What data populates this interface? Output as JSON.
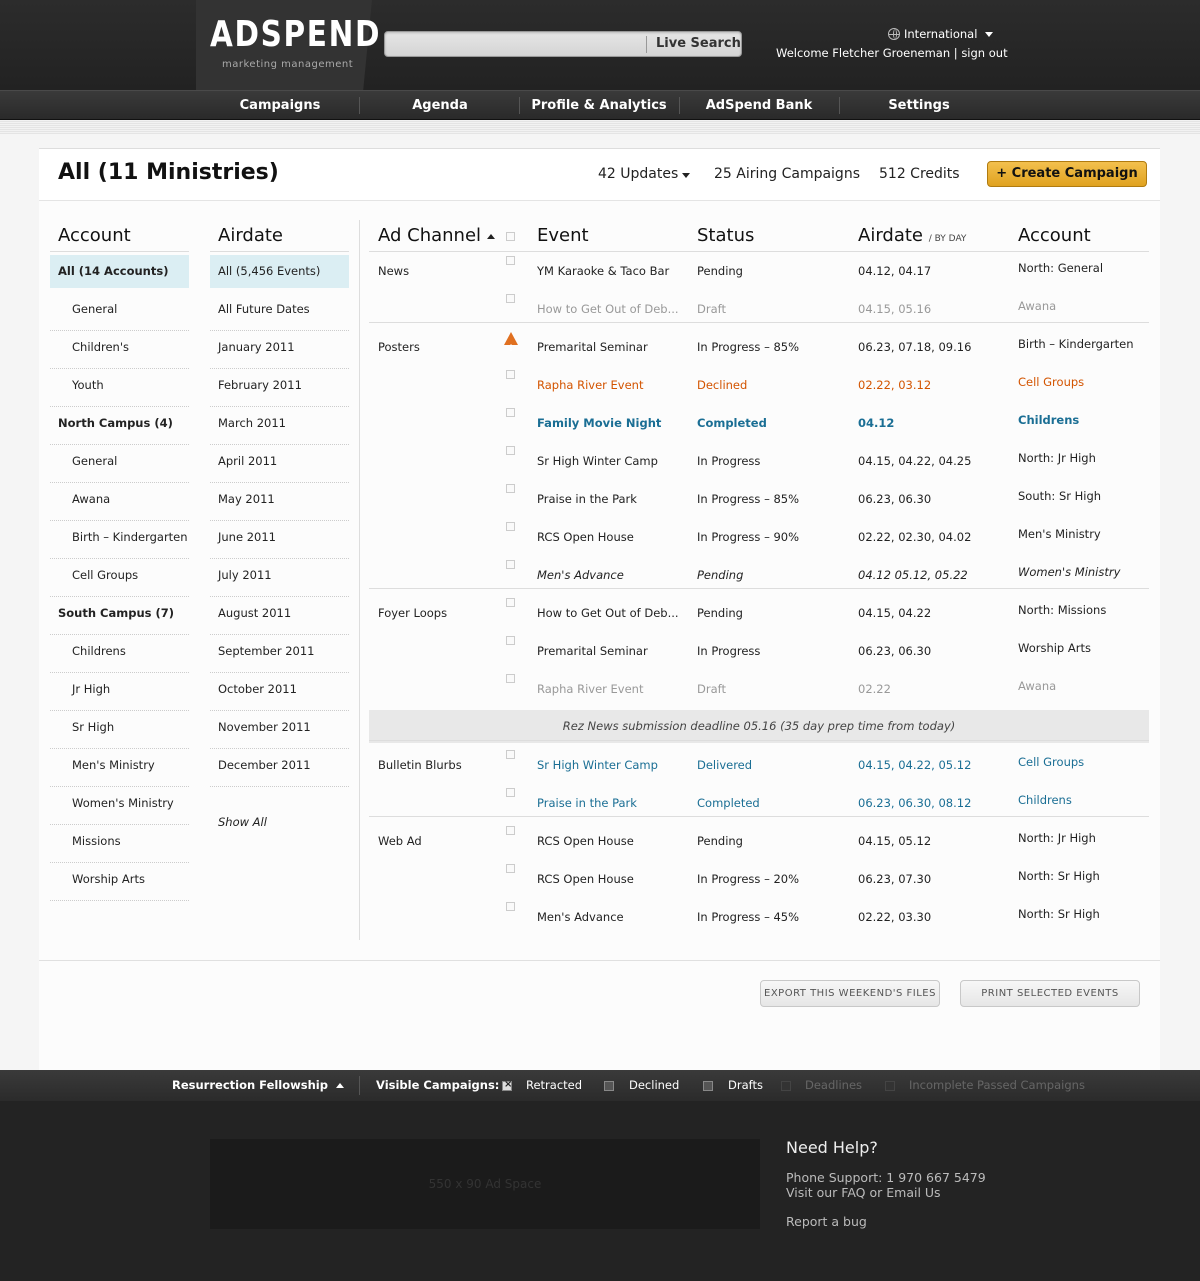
{
  "header": {
    "logo": "ADSPEND",
    "tagline": "marketing management",
    "search": {
      "placeholder": "",
      "label": "Live Search"
    },
    "region": "International",
    "welcome": "Welcome Fletcher Groeneman",
    "sign_out": "sign out"
  },
  "nav": [
    "Campaigns",
    "Agenda",
    "Profile & Analytics",
    "AdSpend Bank",
    "Settings"
  ],
  "titlebar": {
    "title": "All (11 Ministries)",
    "updates": "42 Updates",
    "airing": "25 Airing Campaigns",
    "credits": "512 Credits",
    "create": "+ Create Campaign"
  },
  "headers": {
    "account": "Account",
    "airdate": "Airdate",
    "ad_channel": "Ad Channel",
    "event": "Event",
    "status": "Status",
    "airdate2": "Airdate",
    "airdate2_sub": "/ BY DAY",
    "account2": "Account"
  },
  "accounts": [
    "All (14 Accounts)",
    "General",
    "Children's",
    "Youth",
    "North Campus (4)",
    "General",
    "Awana",
    "Birth – Kindergarten",
    "Cell Groups",
    "South Campus (7)",
    "Childrens",
    "Jr High",
    "Sr High",
    "Men's Ministry",
    "Women's Ministry",
    "Missions",
    "Worship Arts"
  ],
  "airdates": [
    "All (5,456 Events)",
    "All Future Dates",
    "January 2011",
    "February 2011",
    "March 2011",
    "April 2011",
    "May 2011",
    "June 2011",
    "July 2011",
    "August 2011",
    "September 2011",
    "October 2011",
    "November 2011",
    "December 2011"
  ],
  "show_all": "Show All",
  "rows": [
    {
      "channel": "News",
      "event": "YM Karaoke & Taco Bar",
      "status": "Pending",
      "airdate": "04.12, 04.17",
      "account": "North: General"
    },
    {
      "channel": "",
      "event": "How to Get Out of Deb...",
      "status": "Draft",
      "airdate": "04.15, 05.16",
      "account": "Awana"
    },
    {
      "channel": "Posters",
      "event": "Premarital Seminar",
      "status": "In Progress – 85%",
      "airdate": "06.23, 07.18, 09.16",
      "account": "Birth – Kindergarten"
    },
    {
      "channel": "",
      "event": "Rapha River Event",
      "status": "Declined",
      "airdate": "02.22, 03.12",
      "account": "Cell Groups"
    },
    {
      "channel": "",
      "event": "Family Movie Night",
      "status": "Completed",
      "airdate": "04.12",
      "account": "Childrens"
    },
    {
      "channel": "",
      "event": "Sr High Winter Camp",
      "status": "In Progress",
      "airdate": "04.15, 04.22, 04.25",
      "account": "North: Jr High"
    },
    {
      "channel": "",
      "event": "Praise in the Park",
      "status": "In Progress – 85%",
      "airdate": "06.23, 06.30",
      "account": "South: Sr High"
    },
    {
      "channel": "",
      "event": "RCS Open House",
      "status": "In Progress – 90%",
      "airdate": "02.22, 02.30, 04.02",
      "account": "Men's Ministry"
    },
    {
      "channel": "",
      "event": "Men's Advance",
      "status": "Pending",
      "airdate": "04.12 05.12, 05.22",
      "account": "Women's Ministry"
    },
    {
      "channel": "Foyer Loops",
      "event": "How to Get Out of Deb...",
      "status": "Pending",
      "airdate": "04.15, 04.22",
      "account": "North: Missions"
    },
    {
      "channel": "",
      "event": "Premarital Seminar",
      "status": "In Progress",
      "airdate": "06.23, 06.30",
      "account": "Worship Arts"
    },
    {
      "channel": "",
      "event": "Rapha River Event",
      "status": "Draft",
      "airdate": "02.22",
      "account": "Awana"
    },
    {
      "channel": "Bulletin Blurbs",
      "event": "Sr High Winter Camp",
      "status": "Delivered",
      "airdate": "04.15, 04.22, 05.12",
      "account": "Cell Groups"
    },
    {
      "channel": "",
      "event": "Praise in the Park",
      "status": "Completed",
      "airdate": "06.23, 06.30, 08.12",
      "account": "Childrens"
    },
    {
      "channel": "Web Ad",
      "event": "RCS Open House",
      "status": "Pending",
      "airdate": "04.15, 05.12",
      "account": "North: Jr High"
    },
    {
      "channel": "",
      "event": "RCS Open House",
      "status": "In Progress – 20%",
      "airdate": "06.23, 07.30",
      "account": "North: Sr High"
    },
    {
      "channel": "",
      "event": "Men's Advance",
      "status": "In Progress – 45%",
      "airdate": "02.22, 03.30",
      "account": "North: Sr High"
    }
  ],
  "notice": "Rez News submission deadline 05.16 (35 day prep time from today)",
  "actions": {
    "export": "EXPORT THIS WEEKEND'S FILES",
    "print": "PRINT SELECTED EVENTS"
  },
  "footer_bar": {
    "org": "Resurrection Fellowship",
    "visible_label": "Visible Campaigns:",
    "filters": [
      "Retracted",
      "Declined",
      "Drafts",
      "Deadlines",
      "Incomplete Passed Campaigns"
    ]
  },
  "footer": {
    "ad_space": "550 x 90 Ad Space",
    "help_title": "Need Help?",
    "phone": "Phone Support: 1 970 667 5479",
    "faq": "Visit our FAQ or Email Us",
    "bug": "Report a bug"
  },
  "colors": {
    "accent": "#e0a21f",
    "link_blue": "#1a6e94",
    "declined": "#d35400",
    "selected_bg": "#dbeef3"
  }
}
